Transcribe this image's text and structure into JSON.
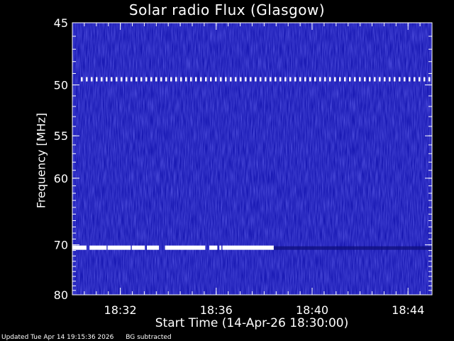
{
  "chart_data": {
    "type": "heatmap",
    "title": "Solar radio Flux (Glasgow)",
    "xlabel": "Start Time (14-Apr-26 18:30:00)",
    "ylabel": "Frequency [MHz]",
    "x_ticks": [
      "18:32",
      "18:36",
      "18:40",
      "18:44"
    ],
    "x_tick_minutes": [
      2,
      6,
      10,
      14
    ],
    "xlim_minutes": [
      0,
      15
    ],
    "y_ticks": [
      45,
      50,
      55,
      60,
      70,
      80
    ],
    "ylim": [
      45,
      80
    ],
    "y_scale": "reciprocal",
    "background_color": "#1a1ab4",
    "features": [
      {
        "name": "interference-band-49-5",
        "freq_mhz": 49.5,
        "minutes": [
          0,
          15
        ],
        "color": "#ffffff"
      },
      {
        "name": "interference-band-70-5",
        "freq_mhz": 70.5,
        "minutes": [
          0,
          8.4
        ],
        "color": "#ffffff"
      }
    ]
  },
  "footer": {
    "updated": "Updated Tue Apr 14 19:15:36 2026",
    "note": "BG subtracted"
  }
}
